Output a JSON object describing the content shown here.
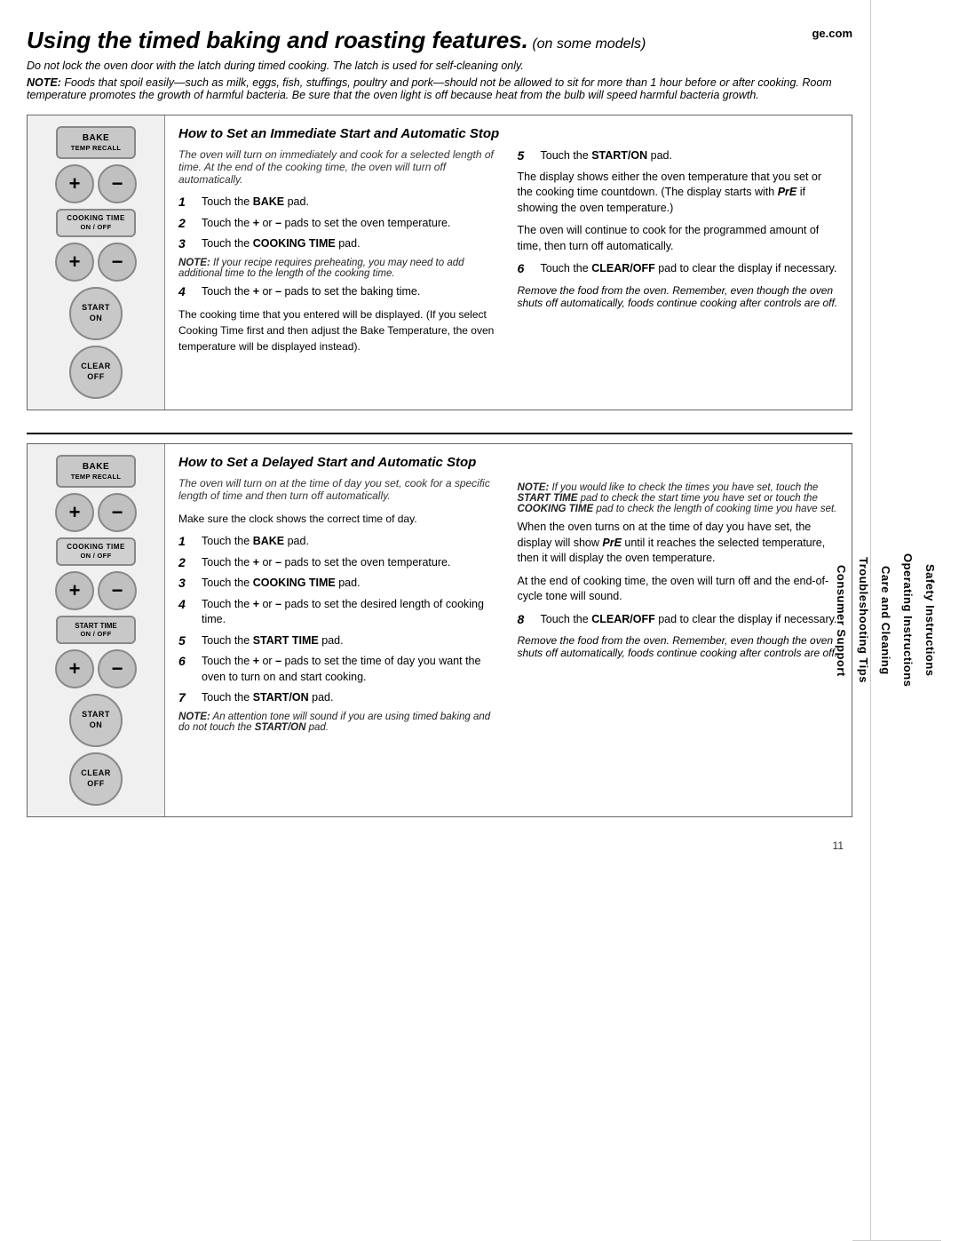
{
  "page": {
    "title": "Using the timed baking and roasting features.",
    "title_suffix": " (on some models)",
    "website": "ge.com",
    "warning": "Do not lock the oven door with the latch during timed cooking. The latch is used for self-cleaning only.",
    "note_label": "NOTE:",
    "note_text": " Foods that spoil easily—such as milk, eggs, fish, stuffings, poultry and pork—should not be allowed to sit for more than 1 hour before or after cooking. Room temperature promotes the growth of harmful bacteria. Be sure that the oven light is off because heat from the bulb will speed harmful bacteria growth.",
    "page_number": "11"
  },
  "sidebar": {
    "sections": [
      "Safety Instructions",
      "Operating Instructions",
      "Care and Cleaning",
      "Troubleshooting Tips",
      "Consumer Support"
    ]
  },
  "section1": {
    "title": "How to Set an Immediate Start and Automatic Stop",
    "intro": "The oven will turn on immediately and cook for a selected length of time. At the end of the cooking time, the oven will turn off automatically.",
    "steps_left": [
      {
        "num": "1",
        "text": "Touch the BAKE pad."
      },
      {
        "num": "2",
        "text": "Touch the + or – pads to set the oven temperature."
      },
      {
        "num": "3",
        "text": "Touch the COOKING TIME pad."
      }
    ],
    "note_between": "NOTE: If your recipe requires preheating, you may need to add additional time to the length of the cooking time.",
    "steps_left2": [
      {
        "num": "4",
        "text": "Touch the + or – pads to set the baking time."
      }
    ],
    "cooking_time_text": "The cooking time that you entered will be displayed. (If you select Cooking Time first and then adjust the Bake Temperature, the oven temperature will be displayed instead).",
    "steps_right": [
      {
        "num": "5",
        "text": "Touch the START/ON pad."
      }
    ],
    "display_text": "The display shows either the oven temperature that you set or the cooking time countdown. (The display starts with PrE if showing the oven temperature.)",
    "continue_text": "The oven will continue to cook for the programmed amount of time, then turn off automatically.",
    "steps_right2": [
      {
        "num": "6",
        "text": "Touch the CLEAR/OFF pad to clear the display if necessary."
      }
    ],
    "remove_text": "Remove the food from the oven. Remember, even though the oven shuts off automatically, foods continue cooking after controls are off."
  },
  "section2": {
    "title": "How to Set a Delayed Start and Automatic Stop",
    "intro": "The oven will turn on at the time of day you set, cook for a specific length of time and then turn off automatically.",
    "clock_text": "Make sure the clock shows the correct time of day.",
    "steps_left": [
      {
        "num": "1",
        "text": "Touch the BAKE pad."
      },
      {
        "num": "2",
        "text": "Touch the + or – pads to set the oven temperature."
      },
      {
        "num": "3",
        "text": "Touch the COOKING TIME pad."
      },
      {
        "num": "4",
        "text": "Touch the + or – pads to set the desired length of cooking time."
      },
      {
        "num": "5",
        "text": "Touch the START TIME pad."
      },
      {
        "num": "6",
        "text": "Touch the + or – pads to set the time of day you want the oven to turn on and start cooking."
      },
      {
        "num": "7",
        "text": "Touch the START/ON pad."
      }
    ],
    "note_bottom": "NOTE: An attention tone will sound if you are using timed baking and do not touch the START/ON pad.",
    "note_right": "NOTE: If you would like to check the times you have set, touch the START TIME pad to check the start time you have set or touch the COOKING TIME pad to check the length of cooking time you have set.",
    "when_turns_on": "When the oven turns on at the time of day you have set, the display will show PrE until it reaches the selected temperature, then it will display the oven temperature.",
    "end_text": "At the end of cooking time, the oven will turn off and the end-of-cycle tone will sound.",
    "steps_right": [
      {
        "num": "8",
        "text": "Touch the CLEAR/OFF pad to clear the display if necessary."
      }
    ],
    "remove_text": "Remove the food from the oven. Remember, even though the oven shuts off automatically, foods continue cooking after controls are off."
  },
  "buttons": {
    "bake": "BAKE",
    "bake_sub": "TEMP RECALL",
    "cooking_time": "COOKING TIME",
    "cooking_time_sub": "ON / OFF",
    "start": "START",
    "start_sub": "ON",
    "start_time": "START TIME",
    "start_time_sub": "ON / OFF",
    "clear": "CLEAR",
    "clear_sub": "OFF",
    "plus": "+",
    "minus": "−"
  }
}
